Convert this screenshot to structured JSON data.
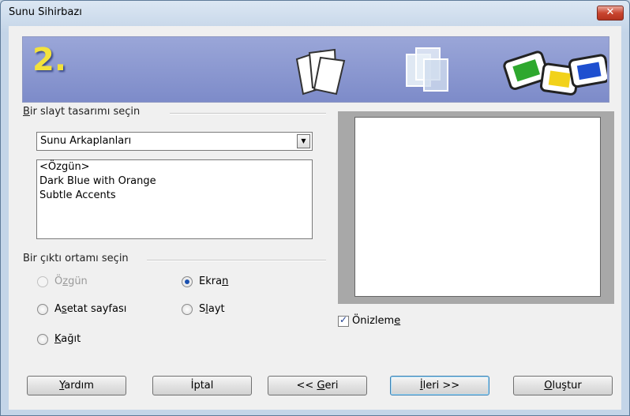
{
  "window": {
    "title": "Sunu Sihirbazı",
    "close_glyph": "✕"
  },
  "banner": {
    "step": "2."
  },
  "design": {
    "group_label_pre": "",
    "group_label_u": "B",
    "group_label_post": "ir slayt tasarımı seçin",
    "category_value": "Sunu Arkaplanları",
    "templates": [
      "<Özgün>",
      "Dark Blue with Orange",
      "Subtle Accents"
    ]
  },
  "output": {
    "group_label": "Bir çıktı ortamı seçin",
    "options": {
      "ozgun": {
        "pre": "Ö",
        "u": "z",
        "post": "gün",
        "selected": false,
        "disabled": true
      },
      "asetat": {
        "pre": "A",
        "u": "s",
        "post": "etat sayfası",
        "selected": false,
        "disabled": false
      },
      "kagit": {
        "pre": "",
        "u": "K",
        "post": "ağıt",
        "selected": false,
        "disabled": false
      },
      "ekran": {
        "pre": "Ekra",
        "u": "n",
        "post": "",
        "selected": true,
        "disabled": false
      },
      "slayt": {
        "pre": "S",
        "u": "l",
        "post": "ayt",
        "selected": false,
        "disabled": false
      }
    }
  },
  "preview_check": {
    "pre": "Önizlem",
    "u": "e",
    "post": "",
    "checked": true
  },
  "buttons": {
    "yardim": {
      "pre": "",
      "u": "Y",
      "post": "ardım"
    },
    "iptal": {
      "pre": "İptal",
      "u": "",
      "post": ""
    },
    "geri": {
      "pre": "<< ",
      "u": "G",
      "post": "eri"
    },
    "ileri": {
      "pre": "",
      "u": "İ",
      "post": "leri >>"
    },
    "olustur": {
      "pre": "",
      "u": "O",
      "post": "luştur"
    }
  }
}
